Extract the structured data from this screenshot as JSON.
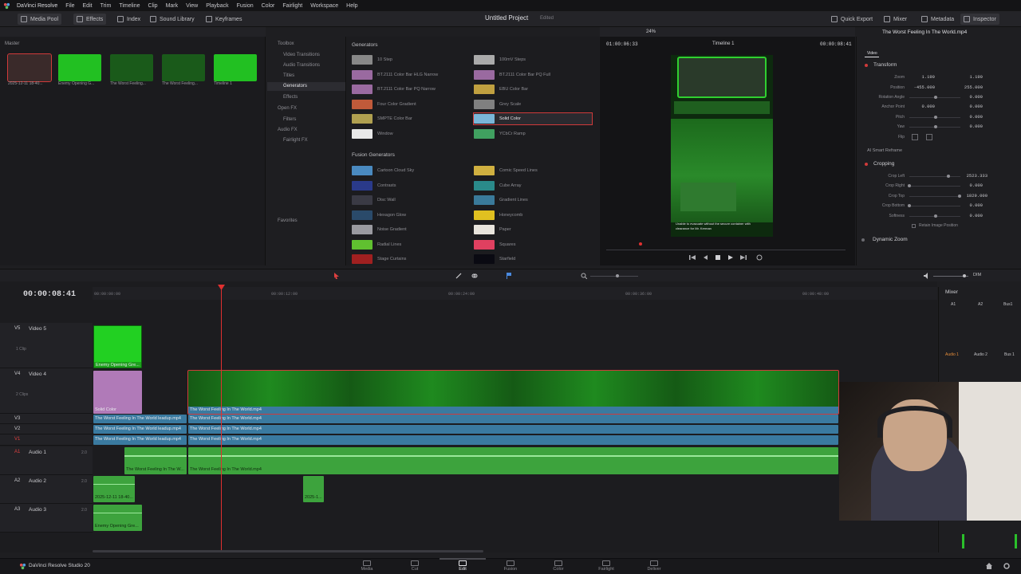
{
  "menubar": {
    "items": [
      "DaVinci Resolve",
      "File",
      "Edit",
      "Trim",
      "Timeline",
      "Clip",
      "Mark",
      "View",
      "Playback",
      "Fusion",
      "Color",
      "Fairlight",
      "Workspace",
      "Help"
    ]
  },
  "toolbar": {
    "media_pool": "Media Pool",
    "effects": "Effects",
    "index": "Index",
    "sound_library": "Sound Library",
    "keyframes": "Keyframes",
    "project_title": "Untitled Project",
    "edited": "Edited",
    "quick_export": "Quick Export",
    "mixer": "Mixer",
    "metadata": "Metadata",
    "inspector": "Inspector"
  },
  "media_pool": {
    "master": "Master",
    "clips": [
      {
        "label": "2025-12-11 18-40...",
        "color": "#3a2a2a"
      },
      {
        "label": "Enemy Opening G...",
        "color": "#22c022"
      },
      {
        "label": "The Worst Feeling...",
        "color": "#1a5a1a"
      },
      {
        "label": "The Worst Feeling...",
        "color": "#1a5a1a"
      },
      {
        "label": "Timeline 1",
        "color": "#22c022"
      }
    ]
  },
  "effects_tree": {
    "toolbox": "Toolbox",
    "video_transitions": "Video Transitions",
    "audio_transitions": "Audio Transitions",
    "titles": "Titles",
    "generators": "Generators",
    "effects": "Effects",
    "open_fx": "Open FX",
    "filters": "Filters",
    "audio_fx": "Audio FX",
    "fairlight_fx": "Fairlight FX",
    "favorites": "Favorites"
  },
  "generators": {
    "title": "Generators",
    "items": [
      {
        "label": "10 Step",
        "swatch": "#888888"
      },
      {
        "label": "100mV Steps",
        "swatch": "#aaaaaa"
      },
      {
        "label": "BT.2111 Color Bar HLG Narrow",
        "swatch": "#9a6aa0"
      },
      {
        "label": "BT.2111 Color Bar PQ Full",
        "swatch": "#9a6aa0"
      },
      {
        "label": "BT.2111 Color Bar PQ Narrow",
        "swatch": "#9a6aa0"
      },
      {
        "label": "EBU Color Bar",
        "swatch": "#c0a040"
      },
      {
        "label": "Four Color Gradient",
        "swatch": "#c05a3a"
      },
      {
        "label": "Grey Scale",
        "swatch": "#808080"
      },
      {
        "label": "SMPTE Color Bar",
        "swatch": "#b0a050"
      },
      {
        "label": "Solid Color",
        "swatch": "#7ab6d8"
      },
      {
        "label": "Window",
        "swatch": "#e8e8e8"
      },
      {
        "label": "YCbCr Ramp",
        "swatch": "#40a060"
      }
    ],
    "fusion_title": "Fusion Generators",
    "fusion_items": [
      {
        "label": "Cartoon Cloud Sky",
        "swatch": "#4a8ac0"
      },
      {
        "label": "Comic Speed Lines",
        "swatch": "#d0b040"
      },
      {
        "label": "Contrasts",
        "swatch": "#2a3a8a"
      },
      {
        "label": "Cube Array",
        "swatch": "#2a8a8a"
      },
      {
        "label": "Disc Wall",
        "swatch": "#3a3a44"
      },
      {
        "label": "Gradient Lines",
        "swatch": "#3a7a9a"
      },
      {
        "label": "Hexagon Glow",
        "swatch": "#2a4a6a"
      },
      {
        "label": "Honeycomb",
        "swatch": "#e0c020"
      },
      {
        "label": "Noise Gradient",
        "swatch": "#9a9aa0"
      },
      {
        "label": "Paper",
        "swatch": "#e8e4dc"
      },
      {
        "label": "Radial Lines",
        "swatch": "#60c030"
      },
      {
        "label": "Squares",
        "swatch": "#e04060"
      },
      {
        "label": "Stage Curtains",
        "swatch": "#a02020"
      },
      {
        "label": "Starfield",
        "swatch": "#0a0a12"
      }
    ]
  },
  "viewer": {
    "timecode_left": "01:00:06:33",
    "zoom": "24%",
    "timeline_name": "Timeline 1",
    "timecode_right": "00:00:08:41",
    "caption_line1": "Unable to evacuate without the secure container with",
    "caption_line2": "clearance for Mr. Kerman"
  },
  "inspector": {
    "clip_name": "The Worst Feeling In The World.mp4",
    "tab_video": "Video",
    "transform": "Transform",
    "zoom_label": "Zoom",
    "zoom_x": "1.190",
    "zoom_y": "1.190",
    "position_label": "Position",
    "position_x": "-455.000",
    "position_y": "255.000",
    "rotation_label": "Rotation Angle",
    "rotation": "0.000",
    "anchor_label": "Anchor Point",
    "anchor_x": "0.000",
    "anchor_y": "0.000",
    "pitch_label": "Pitch",
    "pitch": "0.000",
    "yaw_label": "Yaw",
    "yaw": "0.000",
    "flip_label": "Flip",
    "smart_reframe": "AI Smart Reframe",
    "cropping": "Cropping",
    "crop_left_label": "Crop Left",
    "crop_left": "2523.333",
    "crop_right_label": "Crop Right",
    "crop_right": "0.000",
    "crop_top_label": "Crop Top",
    "crop_top": "1829.000",
    "crop_bottom_label": "Crop Bottom",
    "crop_bottom": "0.000",
    "softness_label": "Softness",
    "softness": "0.000",
    "retain_label": "Retain Image Position",
    "dynamic_zoom": "Dynamic Zoom"
  },
  "timeline": {
    "timecode": "00:00:08:41",
    "ruler": [
      "00:00:00:00",
      "00:00:12:00",
      "00:00:24:00",
      "00:00:36:00",
      "00:00:48:00"
    ],
    "tracks": {
      "v5": {
        "id": "V5",
        "name": "Video 5",
        "sub": "1 Clip"
      },
      "v4": {
        "id": "V4",
        "name": "Video 4",
        "sub": "2 Clips"
      },
      "v3": {
        "id": "V3"
      },
      "v2": {
        "id": "V2"
      },
      "v1": {
        "id": "V1"
      },
      "a1": {
        "id": "A1",
        "name": "Audio 1",
        "ch": "2.0"
      },
      "a2": {
        "id": "A2",
        "name": "Audio 2",
        "ch": "2.0"
      },
      "a3": {
        "id": "A3",
        "name": "Audio 3",
        "ch": "2.0"
      }
    },
    "clips": {
      "v5": "Enemy Opening Gre...",
      "v4_solid": "Solid Color",
      "v4_main": "The Worst Feeling In The World.mp4",
      "v3_a": "The Worst Feeling In The World leadup.mp4",
      "v3_b": "The Worst Feeling In The World.mp4",
      "v2_a": "The Worst Feeling In The World leadup.mp4",
      "v2_b": "The Worst Feeling In The World.mp4",
      "v1_a": "The Worst Feeling In The World leadup.mp4",
      "v1_b": "The Worst Feeling In The World.mp4",
      "a1_a": "The Worst Feeling In The W...",
      "a1_b": "The Worst Feeling In The World.mp4",
      "a2_a": "2025-12-11 18-40...",
      "a2_b": "2025-1...",
      "a3": "Enemy Opening Gre..."
    }
  },
  "mixer": {
    "title": "Mixer",
    "ch1": "A1",
    "ch2": "A2",
    "ch3": "Bus1",
    "audio1": "Audio 1",
    "audio2": "Audio 2",
    "bus": "Bus 1",
    "dim": "DIM"
  },
  "pagebar": {
    "app": "DaVinci Resolve Studio 20",
    "media": "Media",
    "cut": "Cut",
    "edit": "Edit",
    "fusion": "Fusion",
    "color": "Color",
    "fairlight": "Fairlight",
    "deliver": "Deliver"
  }
}
